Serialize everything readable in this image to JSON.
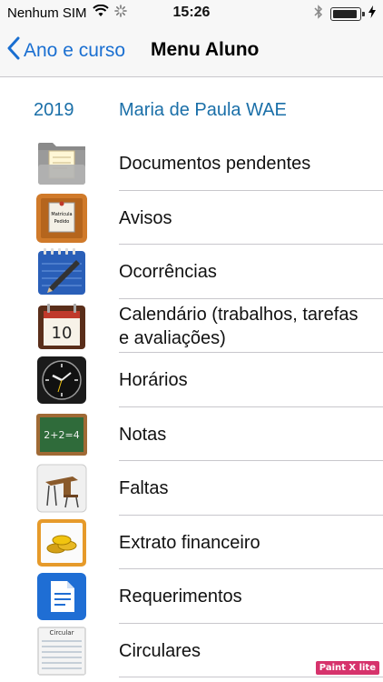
{
  "status_bar": {
    "carrier": "Nenhum SIM",
    "time": "15:26"
  },
  "nav": {
    "back_label": "Ano e curso",
    "title": "Menu Aluno"
  },
  "header": {
    "year": "2019",
    "student_name": "Maria de Paula WAE"
  },
  "menu_items": [
    {
      "label": "Documentos pendentes",
      "icon": "folder-icon"
    },
    {
      "label": "Avisos",
      "icon": "notice-board-icon"
    },
    {
      "label": "Ocorrências",
      "icon": "notepad-pen-icon"
    },
    {
      "label_line1": "Calendário (trabalhos, tarefas",
      "label_line2": "e avaliações)",
      "icon": "calendar-icon"
    },
    {
      "label": "Horários",
      "icon": "clock-icon"
    },
    {
      "label": "Notas",
      "icon": "chalkboard-icon"
    },
    {
      "label": "Faltas",
      "icon": "school-desk-icon"
    },
    {
      "label": "Extrato financeiro",
      "icon": "coins-icon"
    },
    {
      "label": "Requerimentos",
      "icon": "document-icon"
    },
    {
      "label": "Circulares",
      "icon": "circular-paper-icon",
      "icon_text": "Circular"
    }
  ],
  "calendar_icon_day": "10",
  "chalkboard_text": "2+2=4",
  "notice_text_1": "Matrícula",
  "notice_text_2": "Pedido",
  "watermark": "Paint X lite",
  "colors": {
    "accent": "#1a6fd1",
    "header_text": "#1a6fa8",
    "divider": "#c8c7cc"
  }
}
